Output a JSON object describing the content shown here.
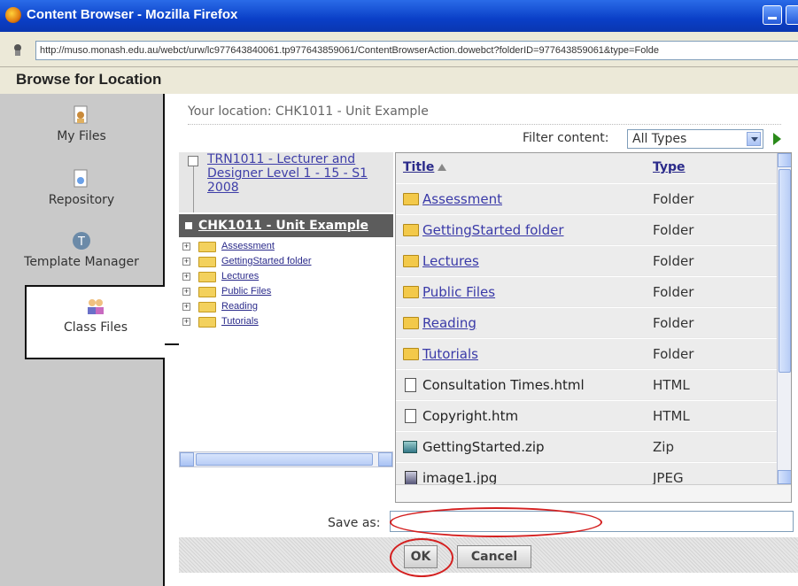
{
  "window": {
    "title": "Content Browser - Mozilla Firefox",
    "url": "http://muso.monash.edu.au/webct/urw/lc977643840061.tp977643859061/ContentBrowserAction.dowebct?folderID=977643859061&type=Folde"
  },
  "page": {
    "heading": "Browse for Location"
  },
  "nav": {
    "items": [
      {
        "label": "My Files",
        "icon": "my-files-icon"
      },
      {
        "label": "Repository",
        "icon": "repository-icon"
      },
      {
        "label": "Template Manager",
        "icon": "template-manager-icon"
      },
      {
        "label": "Class Files",
        "icon": "class-files-icon",
        "active": true
      }
    ]
  },
  "location": {
    "text": "Your location: CHK1011 - Unit Example"
  },
  "filter": {
    "label": "Filter content:",
    "value": "All Types"
  },
  "tree": {
    "parent": "TRN1011 - Lecturer and Designer Level 1 - 15 - S1 2008",
    "current": "CHK1011 - Unit Example",
    "children": [
      "Assessment",
      "GettingStarted folder",
      "Lectures",
      "Public Files",
      "Reading",
      "Tutorials"
    ]
  },
  "grid": {
    "headers": {
      "title": "Title",
      "type": "Type"
    },
    "rows": [
      {
        "name": "Assessment",
        "type": "Folder",
        "kind": "folder"
      },
      {
        "name": "GettingStarted folder",
        "type": "Folder",
        "kind": "folder"
      },
      {
        "name": "Lectures",
        "type": "Folder",
        "kind": "folder"
      },
      {
        "name": "Public Files",
        "type": "Folder",
        "kind": "folder"
      },
      {
        "name": "Reading",
        "type": "Folder",
        "kind": "folder"
      },
      {
        "name": "Tutorials",
        "type": "Folder",
        "kind": "folder"
      },
      {
        "name": "Consultation Times.html",
        "type": "HTML",
        "kind": "file"
      },
      {
        "name": "Copyright.htm",
        "type": "HTML",
        "kind": "file"
      },
      {
        "name": "GettingStarted.zip",
        "type": "Zip",
        "kind": "zip"
      },
      {
        "name": "image1.jpg",
        "type": "JPEG",
        "kind": "img"
      }
    ]
  },
  "save": {
    "label": "Save as:",
    "value": ""
  },
  "buttons": {
    "ok": "OK",
    "cancel": "Cancel"
  },
  "colors": {
    "titlebar": "#0a3fc7",
    "annotation": "#d42020",
    "link": "#3a3aa8",
    "current_node": "#5c5c5c"
  }
}
